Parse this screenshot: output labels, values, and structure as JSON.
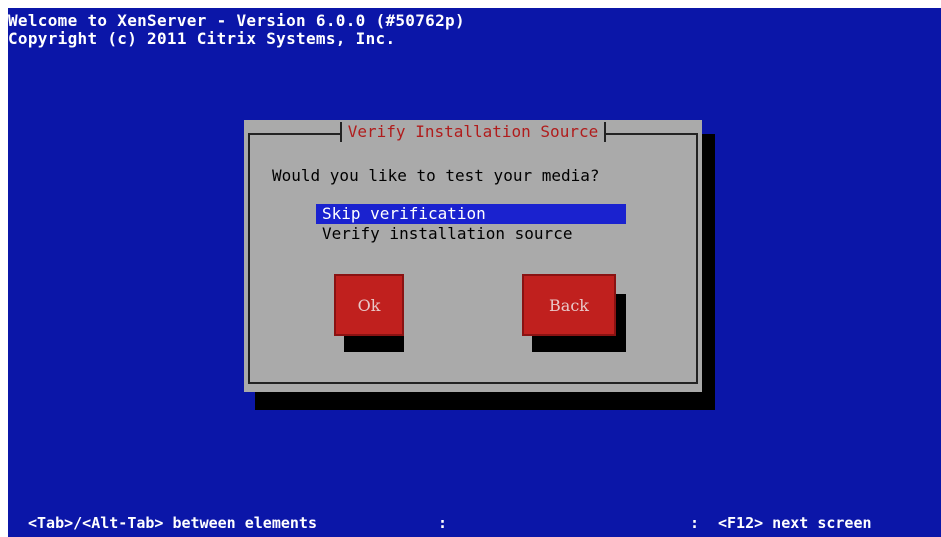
{
  "header": {
    "line1": "Welcome to XenServer - Version 6.0.0 (#50762p)",
    "line2": "Copyright (c) 2011 Citrix Systems, Inc."
  },
  "dialog": {
    "title": "Verify Installation Source",
    "question": "Would you like to test your media?",
    "options": [
      {
        "label": "Skip verification",
        "selected": true
      },
      {
        "label": "Verify installation source",
        "selected": false
      }
    ],
    "buttons": {
      "ok": "Ok",
      "back": "Back"
    }
  },
  "status_bar": {
    "left": "<Tab>/<Alt-Tab> between elements",
    "separator": ":",
    "right": "<F12> next screen"
  },
  "colors": {
    "screen_bg": "#0b16a8",
    "dialog_bg": "#aaaaaa",
    "title_text": "#b01c1c",
    "selection_bg": "#1a22cf",
    "button_bg": "#c0201e"
  }
}
